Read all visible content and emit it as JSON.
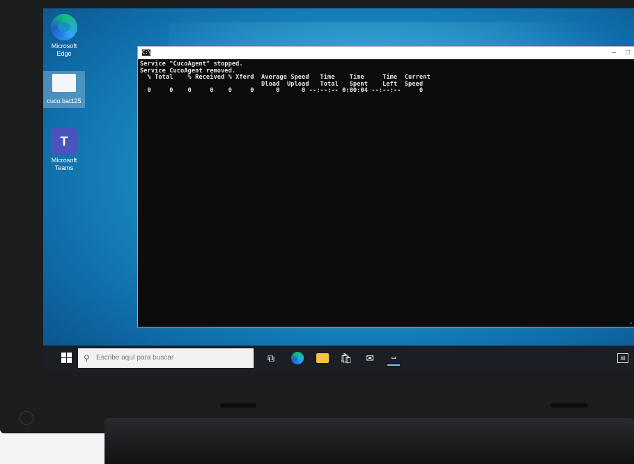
{
  "desktop": {
    "icons": [
      {
        "label": "Microsoft Edge",
        "icon": "edge-icon"
      },
      {
        "label": "cuco.bat125",
        "icon": "file-icon"
      },
      {
        "label": "Microsoft Teams",
        "icon": "teams-icon"
      }
    ]
  },
  "console": {
    "title_icon": "cmd-icon",
    "lines": [
      "Service \"CucoAgent\" stopped.",
      "Service CucoAgent removed.",
      "  % Total    % Received % Xferd  Average Speed   Time    Time     Time  Current",
      "                                 Dload  Upload   Total   Spent    Left  Speed",
      "  0     0    0     0    0     0      0      0 --:--:-- 0:00:04 --:--:--     0"
    ]
  },
  "taskbar": {
    "search_placeholder": "Escribe aquí para buscar",
    "apps": [
      "task-view-icon",
      "edge-icon",
      "file-explorer-icon",
      "store-icon",
      "mail-icon",
      "terminal-icon"
    ]
  }
}
